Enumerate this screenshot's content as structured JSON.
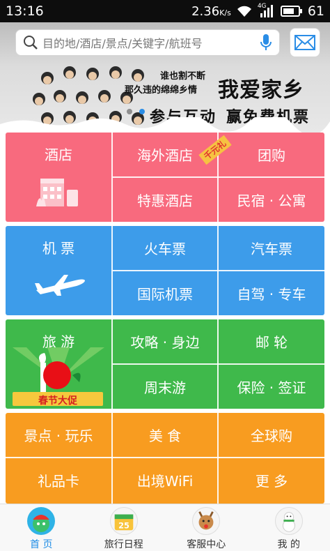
{
  "status_bar": {
    "time": "13:16",
    "speed": "2.36",
    "speed_unit": "K/s",
    "network": "4G",
    "battery": "61"
  },
  "search": {
    "placeholder": "目的地/酒店/景点/关键字/航班号"
  },
  "banner": {
    "line1": "谁也割不断",
    "line2": "那久违的绵绵乡情",
    "line3": "我爱家乡",
    "line4": "参与互动",
    "line5": "赢免费机票"
  },
  "grid": {
    "hotel": {
      "big": "酒店",
      "overseas": "海外酒店",
      "tag": "千元礼",
      "group": "团购",
      "special": "特惠酒店",
      "homestay": "民宿 · 公寓"
    },
    "transport": {
      "big": "机 票",
      "train": "火车票",
      "bus": "汽车票",
      "intl_flight": "国际机票",
      "car": "自驾 · 专车"
    },
    "travel": {
      "big": "旅 游",
      "promo": "春节大促",
      "guide": "攻略 · 身边",
      "cruise": "邮 轮",
      "weekend": "周末游",
      "insurance": "保险 · 签证"
    },
    "more": {
      "sights": "景点 · 玩乐",
      "food": "美 食",
      "shopping": "全球购",
      "giftcard": "礼品卡",
      "wifi": "出境WiFi",
      "more": "更 多"
    }
  },
  "tabs": [
    {
      "label": "首 页",
      "active": true
    },
    {
      "label": "旅行日程",
      "active": false,
      "icon_text": "25"
    },
    {
      "label": "客服中心",
      "active": false
    },
    {
      "label": "我 的",
      "active": false
    }
  ],
  "colors": {
    "hotel": "#f86a7e",
    "transport": "#3d9cea",
    "travel": "#3fb94b",
    "more": "#f89c20",
    "accent": "#1f8de6"
  }
}
